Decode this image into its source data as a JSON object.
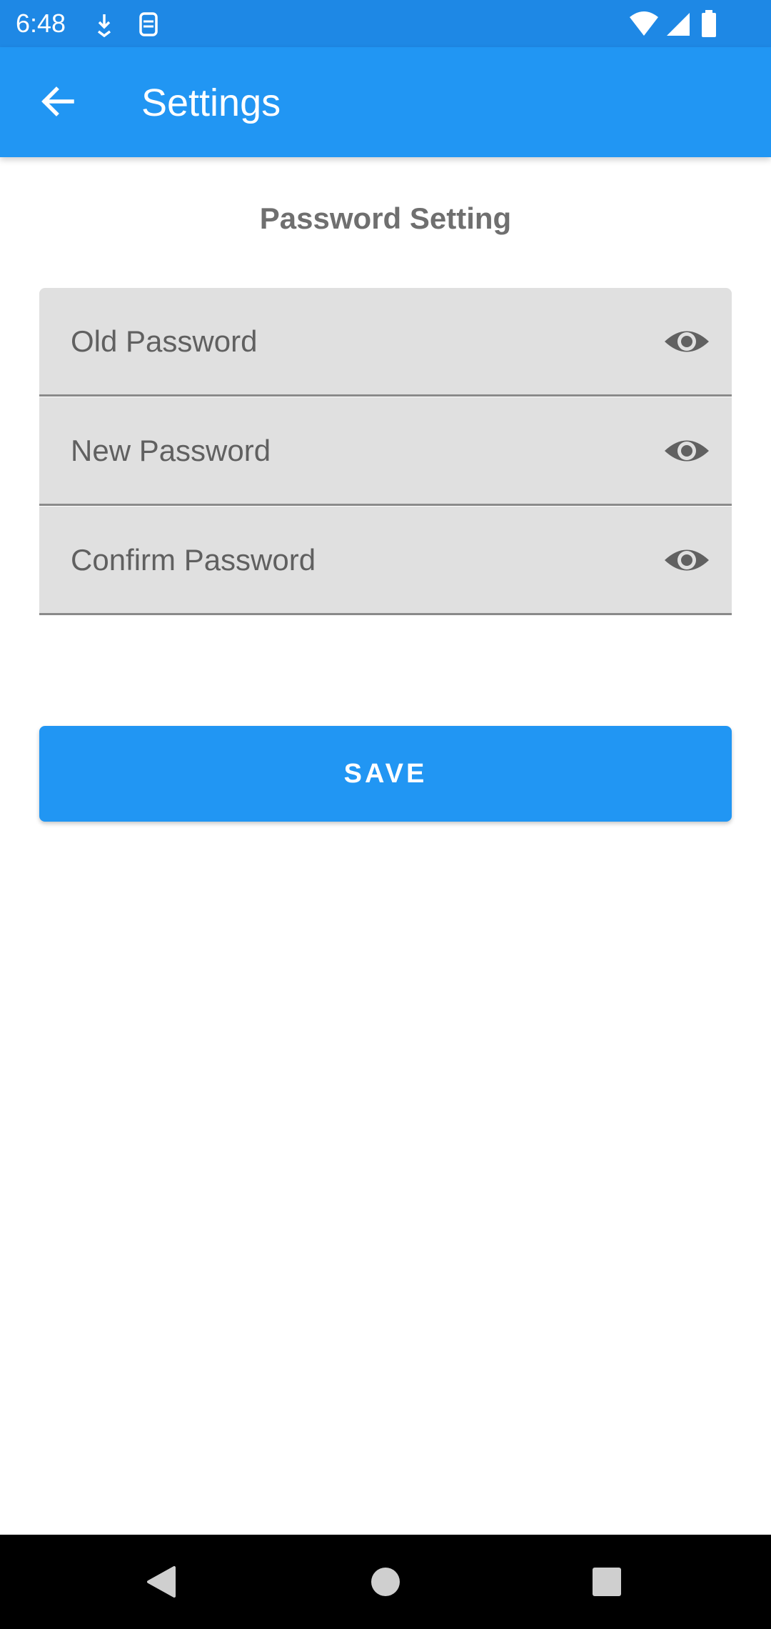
{
  "status_bar": {
    "time": "6:48",
    "left_icons": [
      "download-notification-icon",
      "screenshot-notification-icon"
    ],
    "right_icons": [
      "wifi-icon",
      "cellular-signal-icon",
      "battery-icon"
    ],
    "color": "#1E88E5"
  },
  "app_bar": {
    "title": "Settings",
    "back_icon": "arrow-back-icon",
    "color": "#2196F3"
  },
  "section": {
    "title": "Password Setting"
  },
  "fields": [
    {
      "placeholder": "Old Password",
      "value": "",
      "icon": "eye-icon"
    },
    {
      "placeholder": "New Password",
      "value": "",
      "icon": "eye-icon"
    },
    {
      "placeholder": "Confirm Password",
      "value": "",
      "icon": "eye-icon"
    }
  ],
  "save": {
    "label": "SAVE",
    "color": "#2196F3"
  },
  "nav_bar": {
    "buttons": [
      "back-triangle-icon",
      "home-circle-icon",
      "recents-square-icon"
    ]
  }
}
